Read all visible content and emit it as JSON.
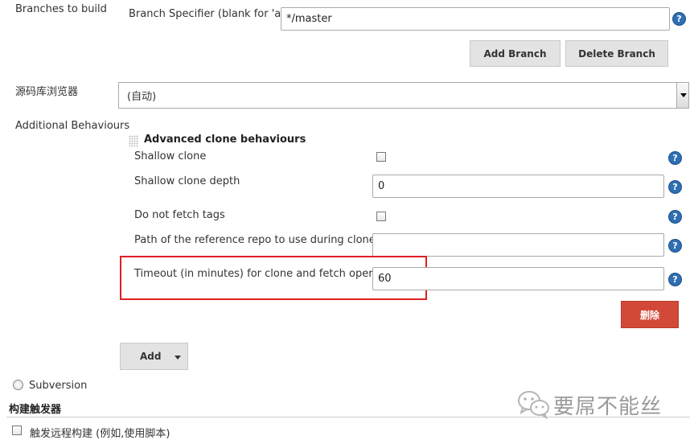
{
  "branches": {
    "section_label": "Branches to build",
    "specifier_label": "Branch Specifier (blank for 'any')",
    "specifier_value": "*/master",
    "add_branch": "Add Branch",
    "delete_branch": "Delete Branch"
  },
  "browser": {
    "label": "源码库浏览器",
    "selected": "(自动)"
  },
  "behaviours": {
    "section_label": "Additional Behaviours",
    "title": "Advanced clone behaviours",
    "shallow_clone": "Shallow clone",
    "shallow_depth_label": "Shallow clone depth",
    "shallow_depth_value": "0",
    "no_tags": "Do not fetch tags",
    "reference_repo_label": "Path of the reference repo to use during clone",
    "reference_repo_value": "",
    "timeout_label": "Timeout (in minutes) for clone and fetch operations",
    "timeout_value": "60",
    "delete_button": "删除",
    "add_button": "Add"
  },
  "scm": {
    "subversion": "Subversion"
  },
  "triggers": {
    "heading": "构建触发器",
    "remote_trigger": "触发远程构建 (例如,使用脚本)"
  },
  "watermark": "要屌不能丝",
  "help_glyph": "?",
  "colors": {
    "help": "#2f6fb3",
    "delete_button": "#d24939",
    "highlight": "#e02020"
  }
}
